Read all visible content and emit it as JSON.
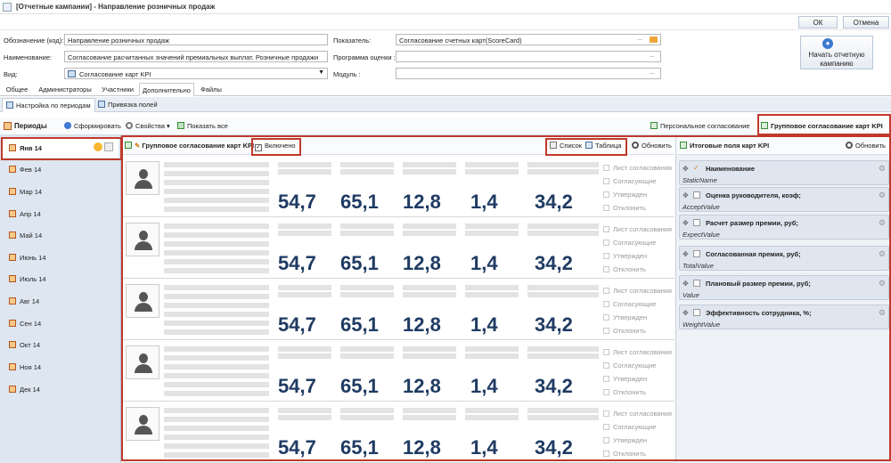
{
  "window": {
    "title": "[Отчетные кампании] - Направление розничных продаж"
  },
  "toolbar": {
    "ok_label": "ОК",
    "cancel_label": "Отмена"
  },
  "form": {
    "code_label": "Обозначение (код):",
    "code_value": "Направление розничных продаж",
    "name_label": "Наименование:",
    "name_value": "Согласование расчитанных значений премиальных выплат. Розничные продажи",
    "kind_label": "Вид:",
    "kind_value": "Согласование карт KPI",
    "indicator_label": "Показатель:",
    "indicator_value": "Согласование счетных карт(ScoreCard)",
    "program_label": "Программа оценки :",
    "program_value": "",
    "module_label": "Модуль :",
    "module_value": "",
    "dots": "...",
    "start_button": "Начать отчетную кампанию"
  },
  "tabs": [
    "Общее",
    "Администраторы",
    "Участники",
    "Дополнительно",
    "Файлы"
  ],
  "subtabs": [
    "Настройка по периодам",
    "Привязка полей"
  ],
  "periods": {
    "title": "Периоды",
    "form_button": "Сформировать",
    "items": [
      "Янв 14",
      "Фев 14",
      "Мар 14",
      "Апр 14",
      "Май 14",
      "Июнь 14",
      "Июль 14",
      "Авг 14",
      "Сен 14",
      "Окт 14",
      "Ноя 14",
      "Дек 14"
    ]
  },
  "main_toolbar": {
    "properties": "Свойства",
    "show_all": "Показать все",
    "personal": "Персональное согласование",
    "group": "Групповое согласование карт KPI"
  },
  "list_toolbar": {
    "title": "Групповое согласование карт KPI",
    "enabled": "Включено",
    "list": "Список",
    "table": "Таблица",
    "refresh": "Обновить"
  },
  "cards": {
    "values": [
      "54,7",
      "65,1",
      "12,8",
      "1,4",
      "34,2"
    ],
    "actions": [
      "Лист согласования",
      "Согласующие",
      "Утвержден",
      "Отклонить"
    ]
  },
  "summary": {
    "title": "Итоговые поля карт KPI",
    "refresh": "Обновить",
    "fields": [
      {
        "title": "Наименование",
        "sub": "StaticName",
        "checked": "✓"
      },
      {
        "title": "Оценка руководителя, коэф;",
        "sub": "AcceptValue",
        "checked": ""
      },
      {
        "title": "Расчет размер премии, руб;",
        "sub": "ExpectValue",
        "checked": ""
      },
      {
        "title": "Согласованная премия, руб;",
        "sub": "TotalValue",
        "checked": ""
      },
      {
        "title": "Плановый размер премии, руб;",
        "sub": "Value",
        "checked": ""
      },
      {
        "title": "Эффективность сотрудника, %;",
        "sub": "WeightValue",
        "checked": ""
      }
    ]
  },
  "colors": {
    "highlight": "#c0392b",
    "value_text": "#1f3b63",
    "panel_bg": "#dde6f1"
  }
}
